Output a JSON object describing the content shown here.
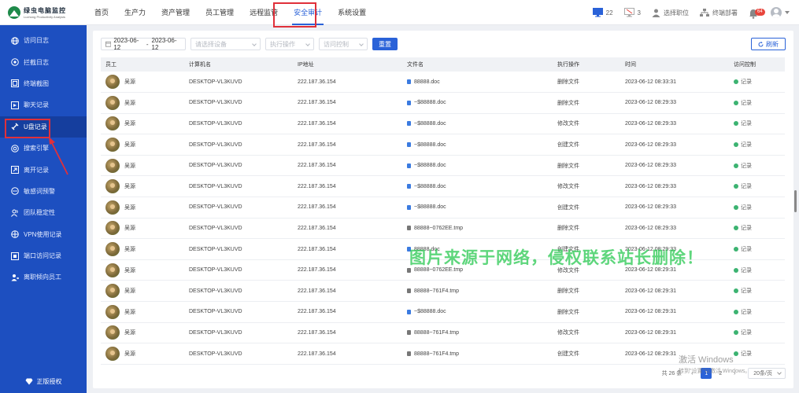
{
  "header": {
    "logo_cn": "绿虫电脑监控",
    "logo_en": "Luchong Productivity Analysis",
    "nav": [
      "首页",
      "生产力",
      "资产管理",
      "员工管理",
      "远程监管",
      "安全审计",
      "系统设置"
    ],
    "active_nav": "安全审计",
    "monitor_count": "22",
    "offline_count": "3",
    "select_position": "选择职位",
    "terminal_deploy": "终端部署",
    "notification_badge": "64"
  },
  "sidebar": {
    "items": [
      "访问日志",
      "拦截日志",
      "终端截图",
      "聊天记录",
      "U盘记录",
      "搜索引擎",
      "离开记录",
      "敏感词预警",
      "团队稳定性",
      "VPN使用记录",
      "端口访问记录",
      "离职倾向员工"
    ],
    "active_item": "U盘记录",
    "footer": "正版授权"
  },
  "filter": {
    "date_start": "2023-06-12",
    "date_sep": "-",
    "date_end": "2023-06-12",
    "device_placeholder": "请选择设备",
    "operation_placeholder": "执行操作",
    "access_placeholder": "访问控制",
    "reset_label": "重置",
    "refresh_label": "刷新"
  },
  "table": {
    "columns": [
      "员工",
      "计算机名",
      "IP地址",
      "文件名",
      "执行操作",
      "时间",
      "访问控制"
    ],
    "rows": [
      {
        "emp": "吴源",
        "pc": "DESKTOP-VL3KUVD",
        "ip": "222.187.36.154",
        "file": "88888.doc",
        "ftype": "doc",
        "op": "删除文件",
        "time": "2023-06-12 08:33:31",
        "ac": "记录"
      },
      {
        "emp": "吴源",
        "pc": "DESKTOP-VL3KUVD",
        "ip": "222.187.36.154",
        "file": "~$88888.doc",
        "ftype": "doc",
        "op": "删除文件",
        "time": "2023-06-12 08:29:33",
        "ac": "记录"
      },
      {
        "emp": "吴源",
        "pc": "DESKTOP-VL3KUVD",
        "ip": "222.187.36.154",
        "file": "~$88888.doc",
        "ftype": "doc",
        "op": "修改文件",
        "time": "2023-06-12 08:29:33",
        "ac": "记录"
      },
      {
        "emp": "吴源",
        "pc": "DESKTOP-VL3KUVD",
        "ip": "222.187.36.154",
        "file": "~$88888.doc",
        "ftype": "doc",
        "op": "创建文件",
        "time": "2023-06-12 08:29:33",
        "ac": "记录"
      },
      {
        "emp": "吴源",
        "pc": "DESKTOP-VL3KUVD",
        "ip": "222.187.36.154",
        "file": "~$88888.doc",
        "ftype": "doc",
        "op": "删除文件",
        "time": "2023-06-12 08:29:33",
        "ac": "记录"
      },
      {
        "emp": "吴源",
        "pc": "DESKTOP-VL3KUVD",
        "ip": "222.187.36.154",
        "file": "~$88888.doc",
        "ftype": "doc",
        "op": "修改文件",
        "time": "2023-06-12 08:29:33",
        "ac": "记录"
      },
      {
        "emp": "吴源",
        "pc": "DESKTOP-VL3KUVD",
        "ip": "222.187.36.154",
        "file": "~$88888.doc",
        "ftype": "doc",
        "op": "创建文件",
        "time": "2023-06-12 08:29:33",
        "ac": "记录"
      },
      {
        "emp": "吴源",
        "pc": "DESKTOP-VL3KUVD",
        "ip": "222.187.36.154",
        "file": "88888~0762EE.tmp",
        "ftype": "tmp",
        "op": "删除文件",
        "time": "2023-06-12 08:29:33",
        "ac": "记录"
      },
      {
        "emp": "吴源",
        "pc": "DESKTOP-VL3KUVD",
        "ip": "222.187.36.154",
        "file": "88888.doc",
        "ftype": "doc",
        "op": "创建文件",
        "time": "2023-06-12 08:29:33",
        "ac": "记录"
      },
      {
        "emp": "吴源",
        "pc": "DESKTOP-VL3KUVD",
        "ip": "222.187.36.154",
        "file": "88888~0762EE.tmp",
        "ftype": "tmp",
        "op": "修改文件",
        "time": "2023-06-12 08:29:31",
        "ac": "记录"
      },
      {
        "emp": "吴源",
        "pc": "DESKTOP-VL3KUVD",
        "ip": "222.187.36.154",
        "file": "88888~761F4.tmp",
        "ftype": "tmp",
        "op": "删除文件",
        "time": "2023-06-12 08:29:31",
        "ac": "记录"
      },
      {
        "emp": "吴源",
        "pc": "DESKTOP-VL3KUVD",
        "ip": "222.187.36.154",
        "file": "~$88888.doc",
        "ftype": "doc",
        "op": "删除文件",
        "time": "2023-06-12 08:29:31",
        "ac": "记录"
      },
      {
        "emp": "吴源",
        "pc": "DESKTOP-VL3KUVD",
        "ip": "222.187.36.154",
        "file": "88888~761F4.tmp",
        "ftype": "tmp",
        "op": "修改文件",
        "time": "2023-06-12 08:29:31",
        "ac": "记录"
      },
      {
        "emp": "吴源",
        "pc": "DESKTOP-VL3KUVD",
        "ip": "222.187.36.154",
        "file": "88888~761F4.tmp",
        "ftype": "tmp",
        "op": "创建文件",
        "time": "2023-06-12 08:29:31",
        "ac": "记录"
      }
    ]
  },
  "pagination": {
    "total": "共 26 条",
    "pages": [
      "1",
      "2"
    ],
    "current": "1",
    "page_size": "20条/页"
  },
  "overlays": {
    "watermark": "图片来源于网络，侵权联系站长删除！",
    "win_line1": "激活 Windows",
    "win_line2": "转到\"设置\"以激活 Windows。"
  },
  "colors": {
    "accent": "#2a62d8",
    "sidebar_bg": "#1d4fc0",
    "highlight_red": "#e0303a",
    "watermark_green": "#28c850"
  }
}
